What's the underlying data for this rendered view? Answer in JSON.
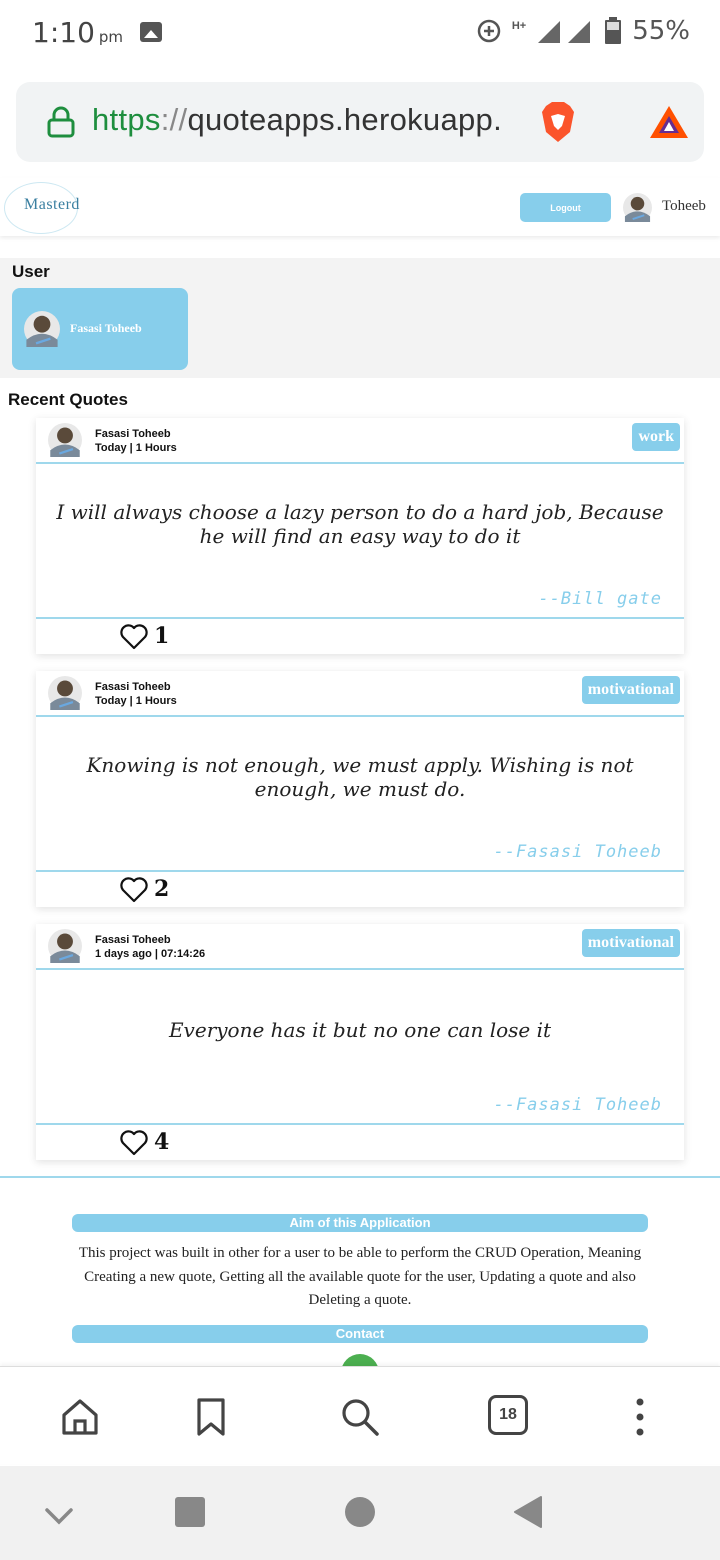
{
  "status_bar": {
    "time": "1:10",
    "ampm": "pm",
    "network": "H+",
    "battery": "55%"
  },
  "browser": {
    "url_scheme": "https",
    "url_sep": "://",
    "url_host": "quoteapps.herokuapp.",
    "tabs_count": "18"
  },
  "header": {
    "logo_text": "Masterd",
    "logout_label": "Logout",
    "user_name": "Toheeb"
  },
  "user_section": {
    "heading": "User",
    "card_name": "Fasasi Toheeb"
  },
  "recent": {
    "heading": "Recent Quotes",
    "quotes": [
      {
        "author_name": "Fasasi Toheeb",
        "time": "Today | 1 Hours",
        "tag": "work",
        "text": "I will always choose a lazy person to do a hard job, Because he will find an easy way to do it",
        "attribution": "--Bill gate",
        "likes": "1"
      },
      {
        "author_name": "Fasasi Toheeb",
        "time": "Today | 1 Hours",
        "tag": "motivational",
        "text": "Knowing is not enough, we must apply. Wishing is not enough, we must do.",
        "attribution": "--Fasasi Toheeb",
        "likes": "2"
      },
      {
        "author_name": "Fasasi Toheeb",
        "time": "1 days ago | 07:14:26",
        "tag": "motivational",
        "text": "Everyone has it but no one can lose it",
        "attribution": "--Fasasi Toheeb",
        "likes": "4"
      }
    ]
  },
  "footer": {
    "aim_heading": "Aim of this Application",
    "aim_text": "This project was built in other for a user to be able to perform the CRUD Operation, Meaning Creating a new quote, Getting all the available quote for the user, Updating a quote and also Deleting a quote.",
    "contact_heading": "Contact"
  },
  "colors": {
    "accent": "#87ceeb",
    "url_green": "#1e8e3e"
  },
  "icons": [
    "image-icon",
    "data-saver-icon",
    "signal-icon",
    "battery-icon",
    "lock-icon",
    "brave-icon",
    "bat-icon",
    "heart-icon",
    "whatsapp-icon",
    "home-icon",
    "bookmark-icon",
    "search-icon",
    "tabs-icon",
    "more-icon",
    "back-icon",
    "home-circle-icon",
    "recents-icon",
    "collapse-icon"
  ]
}
